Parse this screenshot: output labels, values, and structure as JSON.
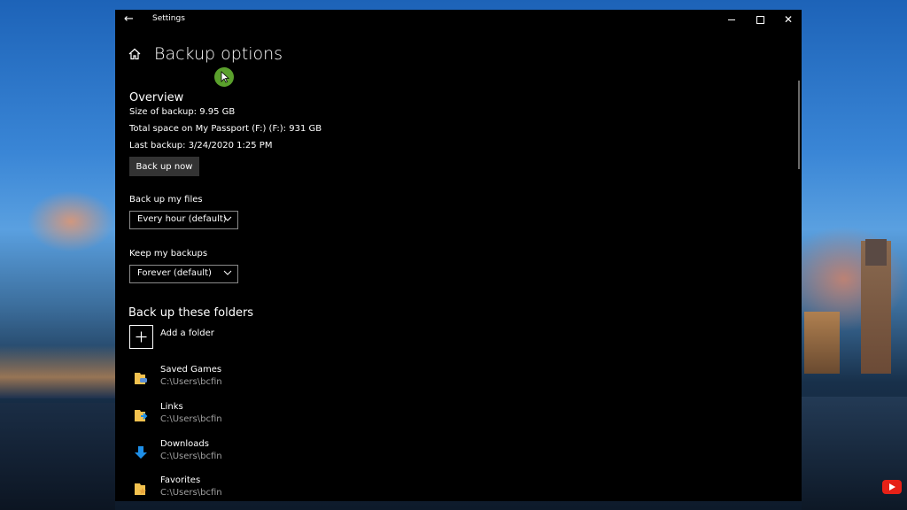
{
  "window": {
    "title": "Settings"
  },
  "page": {
    "title": "Backup options"
  },
  "overview": {
    "heading": "Overview",
    "size": "Size of backup: 9.95 GB",
    "space": "Total space on My Passport (F:) (F:): 931 GB",
    "last": "Last backup: 3/24/2020 1:25 PM",
    "backup_now": "Back up now"
  },
  "frequency": {
    "label": "Back up my files",
    "value": "Every hour (default)"
  },
  "retention": {
    "label": "Keep my backups",
    "value": "Forever (default)"
  },
  "folders": {
    "heading": "Back up these folders",
    "add_label": "Add a folder",
    "items": [
      {
        "name": "Saved Games",
        "path": "C:\\Users\\bcfin",
        "icon": "saved-games-folder-icon"
      },
      {
        "name": "Links",
        "path": "C:\\Users\\bcfin",
        "icon": "links-folder-icon"
      },
      {
        "name": "Downloads",
        "path": "C:\\Users\\bcfin",
        "icon": "downloads-folder-icon"
      },
      {
        "name": "Favorites",
        "path": "C:\\Users\\bcfin",
        "icon": "favorites-folder-icon"
      }
    ]
  },
  "colors": {
    "window_bg": "#000000",
    "button_bg": "#333333",
    "folder_yellow": "#f3c24f",
    "download_blue": "#1e8fe8"
  }
}
